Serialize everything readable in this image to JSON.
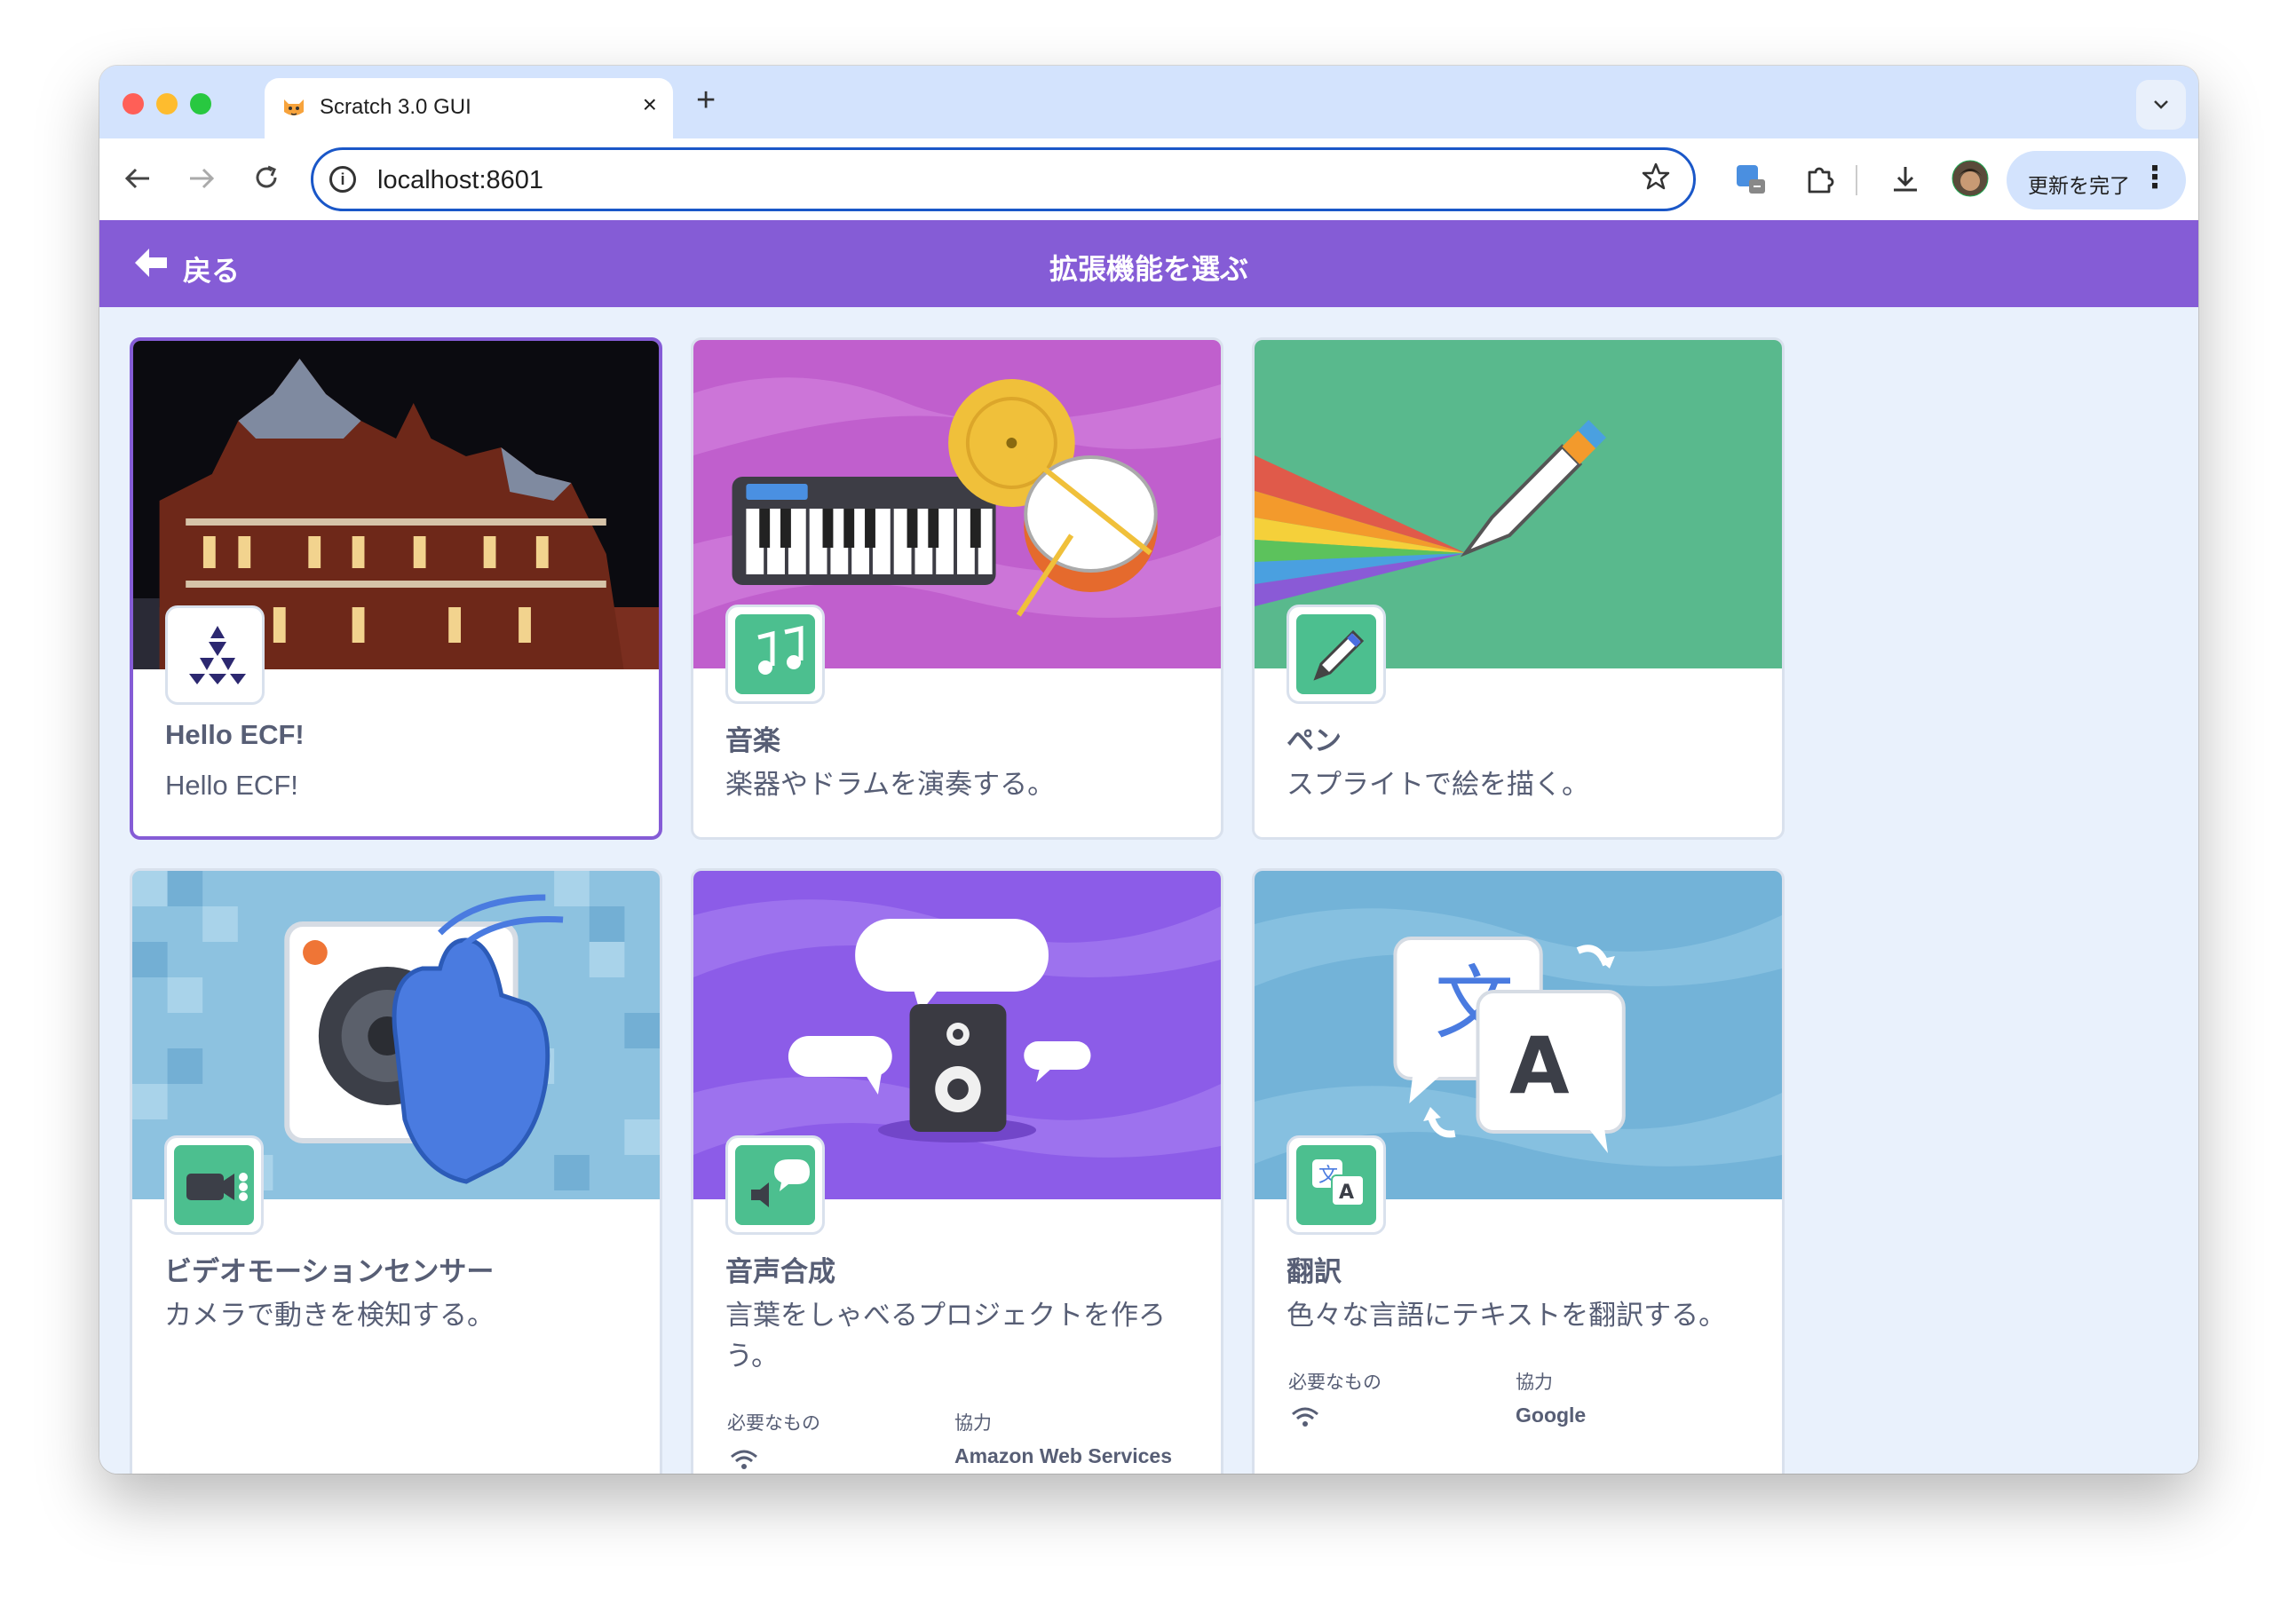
{
  "browser": {
    "tab_title": "Scratch 3.0 GUI",
    "tab_close": "×",
    "new_tab": "+",
    "tab_menu": "⌄",
    "url": "localhost:8601",
    "update_button": "更新を完了",
    "menu_dots": "⋮"
  },
  "header": {
    "back_label": "戻る",
    "title": "拡張機能を選ぶ"
  },
  "extensions": [
    {
      "name": "Hello ECF!",
      "description": "Hello ECF!"
    },
    {
      "name": "音楽",
      "description": "楽器やドラムを演奏する。"
    },
    {
      "name": "ペン",
      "description": "スプライトで絵を描く。"
    },
    {
      "name": "ビデオモーションセンサー",
      "description": "カメラで動きを検知する。"
    },
    {
      "name": "音声合成",
      "description": "言葉をしゃべるプロジェクトを作ろう。",
      "requires_label": "必要なもの",
      "collab_label": "協力",
      "collaborator": "Amazon Web Services"
    },
    {
      "name": "翻訳",
      "description": "色々な言語にテキストを翻訳する。",
      "requires_label": "必要なもの",
      "collab_label": "協力",
      "collaborator": "Google"
    }
  ],
  "icons": [
    "info-icon",
    "star-icon",
    "back-arrow-icon",
    "forward-arrow-icon",
    "reload-icon",
    "extension-puzzle-icon",
    "download-icon",
    "wifi-icon"
  ],
  "colors": {
    "header": "#855cd6",
    "icon_green": "#4cbf8f",
    "selected_border": "#855cd6",
    "text": "#575e75"
  }
}
